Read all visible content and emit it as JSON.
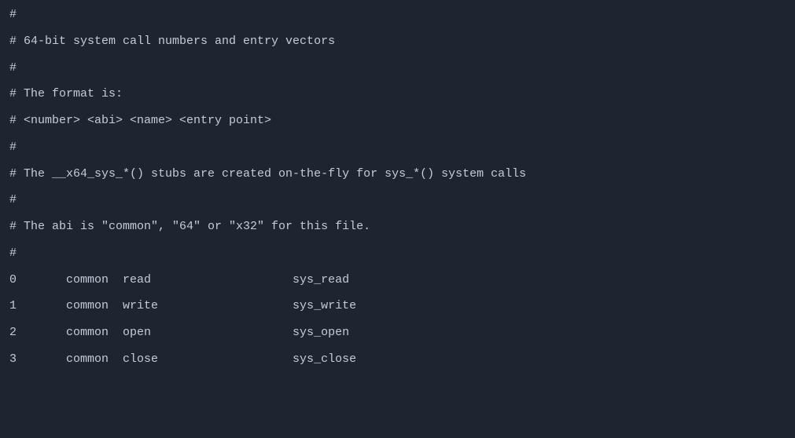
{
  "lines": {
    "c0": "#",
    "c1": "# 64-bit system call numbers and entry vectors",
    "c2": "#",
    "c3": "# The format is:",
    "c4": "# <number> <abi> <name> <entry point>",
    "c5": "#",
    "c6": "# The __x64_sys_*() stubs are created on-the-fly for sys_*() system calls",
    "c7": "#",
    "c8": "# The abi is \"common\", \"64\" or \"x32\" for this file.",
    "c9": "#"
  },
  "rows": {
    "r0": "0       common  read                    sys_read",
    "r1": "1       common  write                   sys_write",
    "r2": "2       common  open                    sys_open",
    "r3": "3       common  close                   sys_close"
  },
  "chart_data": {
    "type": "table",
    "headers": [
      "number",
      "abi",
      "name",
      "entry point"
    ],
    "rows": [
      {
        "number": 0,
        "abi": "common",
        "name": "read",
        "entry_point": "sys_read"
      },
      {
        "number": 1,
        "abi": "common",
        "name": "write",
        "entry_point": "sys_write"
      },
      {
        "number": 2,
        "abi": "common",
        "name": "open",
        "entry_point": "sys_open"
      },
      {
        "number": 3,
        "abi": "common",
        "name": "close",
        "entry_point": "sys_close"
      }
    ]
  }
}
